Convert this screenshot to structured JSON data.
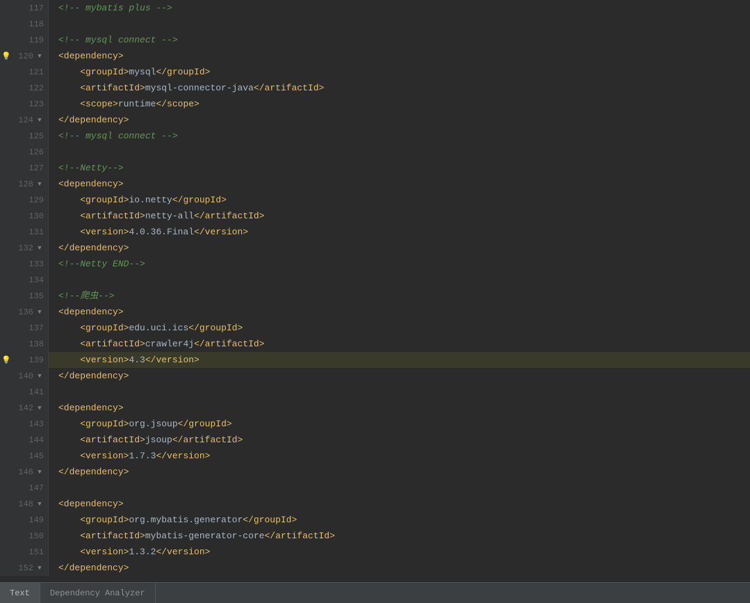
{
  "editor": {
    "lines": [
      {
        "num": 117,
        "indent": 0,
        "type": "comment",
        "content": "<!-- mybatis plus -->",
        "fold": false,
        "bulb": false,
        "highlighted": false
      },
      {
        "num": 118,
        "indent": 0,
        "type": "empty",
        "content": "",
        "fold": false,
        "bulb": false,
        "highlighted": false
      },
      {
        "num": 119,
        "indent": 0,
        "type": "comment",
        "content": "<!-- mysql connect -->",
        "fold": false,
        "bulb": false,
        "highlighted": false
      },
      {
        "num": 120,
        "indent": 0,
        "type": "open-tag",
        "content": "<dependency>",
        "fold": true,
        "bulb": true,
        "highlighted": false
      },
      {
        "num": 121,
        "indent": 1,
        "type": "element",
        "content": "<groupId>mysql</groupId>",
        "fold": false,
        "bulb": false,
        "highlighted": false
      },
      {
        "num": 122,
        "indent": 1,
        "type": "element",
        "content": "<artifactId>mysql-connector-java</artifactId>",
        "fold": false,
        "bulb": false,
        "highlighted": false
      },
      {
        "num": 123,
        "indent": 1,
        "type": "element",
        "content": "<scope>runtime</scope>",
        "fold": false,
        "bulb": false,
        "highlighted": false
      },
      {
        "num": 124,
        "indent": 0,
        "type": "close-tag",
        "content": "</dependency>",
        "fold": true,
        "bulb": false,
        "highlighted": false
      },
      {
        "num": 125,
        "indent": 0,
        "type": "comment",
        "content": "<!-- mysql connect -->",
        "fold": false,
        "bulb": false,
        "highlighted": false
      },
      {
        "num": 126,
        "indent": 0,
        "type": "empty",
        "content": "",
        "fold": false,
        "bulb": false,
        "highlighted": false
      },
      {
        "num": 127,
        "indent": 0,
        "type": "comment",
        "content": "<!--Netty-->",
        "fold": false,
        "bulb": false,
        "highlighted": false
      },
      {
        "num": 128,
        "indent": 0,
        "type": "open-tag",
        "content": "<dependency>",
        "fold": true,
        "bulb": false,
        "highlighted": false
      },
      {
        "num": 129,
        "indent": 1,
        "type": "element",
        "content": "<groupId>io.netty</groupId>",
        "fold": false,
        "bulb": false,
        "highlighted": false
      },
      {
        "num": 130,
        "indent": 1,
        "type": "element",
        "content": "<artifactId>netty-all</artifactId>",
        "fold": false,
        "bulb": false,
        "highlighted": false
      },
      {
        "num": 131,
        "indent": 1,
        "type": "element",
        "content": "<version>4.0.36.Final</version>",
        "fold": false,
        "bulb": false,
        "highlighted": false
      },
      {
        "num": 132,
        "indent": 0,
        "type": "close-tag",
        "content": "</dependency>",
        "fold": true,
        "bulb": false,
        "highlighted": false
      },
      {
        "num": 133,
        "indent": 0,
        "type": "comment",
        "content": "<!--Netty END-->",
        "fold": false,
        "bulb": false,
        "highlighted": false
      },
      {
        "num": 134,
        "indent": 0,
        "type": "empty",
        "content": "",
        "fold": false,
        "bulb": false,
        "highlighted": false
      },
      {
        "num": 135,
        "indent": 0,
        "type": "comment",
        "content": "<!--爬虫-->",
        "fold": false,
        "bulb": false,
        "highlighted": false
      },
      {
        "num": 136,
        "indent": 0,
        "type": "open-tag",
        "content": "<dependency>",
        "fold": true,
        "bulb": false,
        "highlighted": false
      },
      {
        "num": 137,
        "indent": 1,
        "type": "element",
        "content": "<groupId>edu.uci.ics</groupId>",
        "fold": false,
        "bulb": false,
        "highlighted": false
      },
      {
        "num": 138,
        "indent": 1,
        "type": "element",
        "content": "<artifactId>crawler4j</artifactId>",
        "fold": false,
        "bulb": false,
        "highlighted": false
      },
      {
        "num": 139,
        "indent": 1,
        "type": "element-hl",
        "content": "<version>4.3</version>",
        "fold": false,
        "bulb": true,
        "highlighted": true
      },
      {
        "num": 140,
        "indent": 0,
        "type": "close-tag",
        "content": "</dependency>",
        "fold": true,
        "bulb": false,
        "highlighted": false
      },
      {
        "num": 141,
        "indent": 0,
        "type": "empty",
        "content": "",
        "fold": false,
        "bulb": false,
        "highlighted": false
      },
      {
        "num": 142,
        "indent": 0,
        "type": "open-tag",
        "content": "<dependency>",
        "fold": true,
        "bulb": false,
        "highlighted": false
      },
      {
        "num": 143,
        "indent": 1,
        "type": "element",
        "content": "<groupId>org.jsoup</groupId>",
        "fold": false,
        "bulb": false,
        "highlighted": false
      },
      {
        "num": 144,
        "indent": 1,
        "type": "element",
        "content": "<artifactId>jsoup</artifactId>",
        "fold": false,
        "bulb": false,
        "highlighted": false
      },
      {
        "num": 145,
        "indent": 1,
        "type": "element",
        "content": "<version>1.7.3</version>",
        "fold": false,
        "bulb": false,
        "highlighted": false
      },
      {
        "num": 146,
        "indent": 0,
        "type": "close-tag",
        "content": "</dependency>",
        "fold": true,
        "bulb": false,
        "highlighted": false
      },
      {
        "num": 147,
        "indent": 0,
        "type": "empty",
        "content": "",
        "fold": false,
        "bulb": false,
        "highlighted": false
      },
      {
        "num": 148,
        "indent": 0,
        "type": "open-tag",
        "content": "<dependency>",
        "fold": true,
        "bulb": false,
        "highlighted": false
      },
      {
        "num": 149,
        "indent": 1,
        "type": "element",
        "content": "<groupId>org.mybatis.generator</groupId>",
        "fold": false,
        "bulb": false,
        "highlighted": false
      },
      {
        "num": 150,
        "indent": 1,
        "type": "element",
        "content": "<artifactId>mybatis-generator-core</artifactId>",
        "fold": false,
        "bulb": false,
        "highlighted": false
      },
      {
        "num": 151,
        "indent": 1,
        "type": "element",
        "content": "<version>1.3.2</version>",
        "fold": false,
        "bulb": false,
        "highlighted": false
      },
      {
        "num": 152,
        "indent": 0,
        "type": "close-tag",
        "content": "</dependency>",
        "fold": true,
        "bulb": false,
        "highlighted": false
      }
    ]
  },
  "tabs": [
    {
      "id": "text",
      "label": "Text",
      "active": true
    },
    {
      "id": "dependency-analyzer",
      "label": "Dependency Analyzer",
      "active": false
    }
  ],
  "colors": {
    "tag": "#e8bf6a",
    "comment": "#629755",
    "value": "#6a8759",
    "default": "#a9b7c6",
    "lineHighlight": "#3a3a2a",
    "bulb": "#f0c060"
  }
}
